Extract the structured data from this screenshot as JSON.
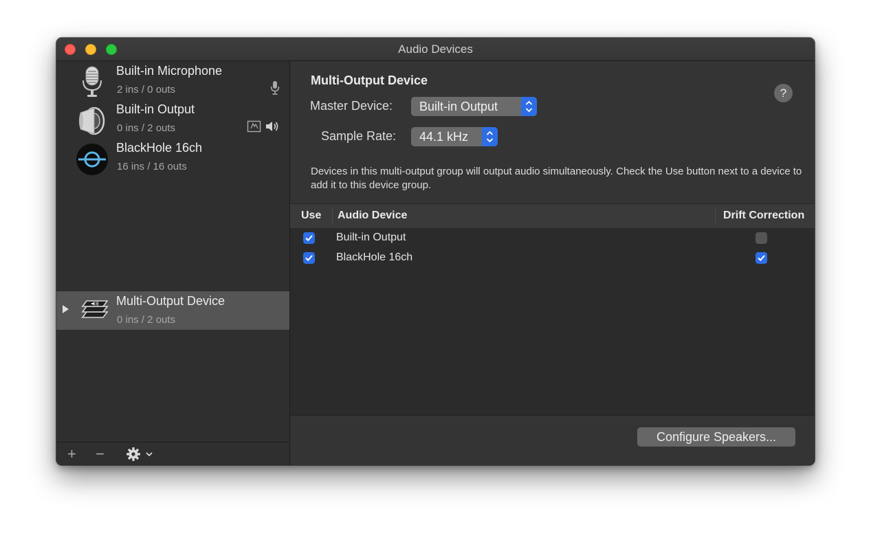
{
  "window": {
    "title": "Audio Devices"
  },
  "sidebar": {
    "devices": [
      {
        "name": "Built-in Microphone",
        "io": "2 ins / 0 outs",
        "icon": "microphone-icon"
      },
      {
        "name": "Built-in Output",
        "io": "0 ins / 2 outs",
        "icon": "speaker-icon"
      },
      {
        "name": "BlackHole 16ch",
        "io": "16 ins / 16 outs",
        "icon": "blackhole-icon"
      },
      {
        "name": "Multi-Output Device",
        "io": "0 ins / 2 outs",
        "icon": "multi-output-icon",
        "selected": true
      }
    ],
    "footer": {
      "add_label": "+",
      "remove_label": "−"
    }
  },
  "detail": {
    "title": "Multi-Output Device",
    "help_label": "?",
    "master_device_label": "Master Device:",
    "master_device_value": "Built-in Output",
    "sample_rate_label": "Sample Rate:",
    "sample_rate_value": "44.1 kHz",
    "description": "Devices in this multi-output group will output audio simultaneously. Check the Use button next to a device to add it to this device group.",
    "table": {
      "headers": {
        "use": "Use",
        "device": "Audio Device",
        "drift": "Drift Correction"
      },
      "rows": [
        {
          "use": true,
          "device": "Built-in Output",
          "drift": false
        },
        {
          "use": true,
          "device": "BlackHole 16ch",
          "drift": true
        }
      ]
    },
    "configure_button": "Configure Speakers..."
  },
  "colors": {
    "accent": "#2d6ee6",
    "window_bg": "#323232",
    "close": "#fe5f57",
    "minimize": "#febc2e",
    "maximize": "#28c840"
  }
}
